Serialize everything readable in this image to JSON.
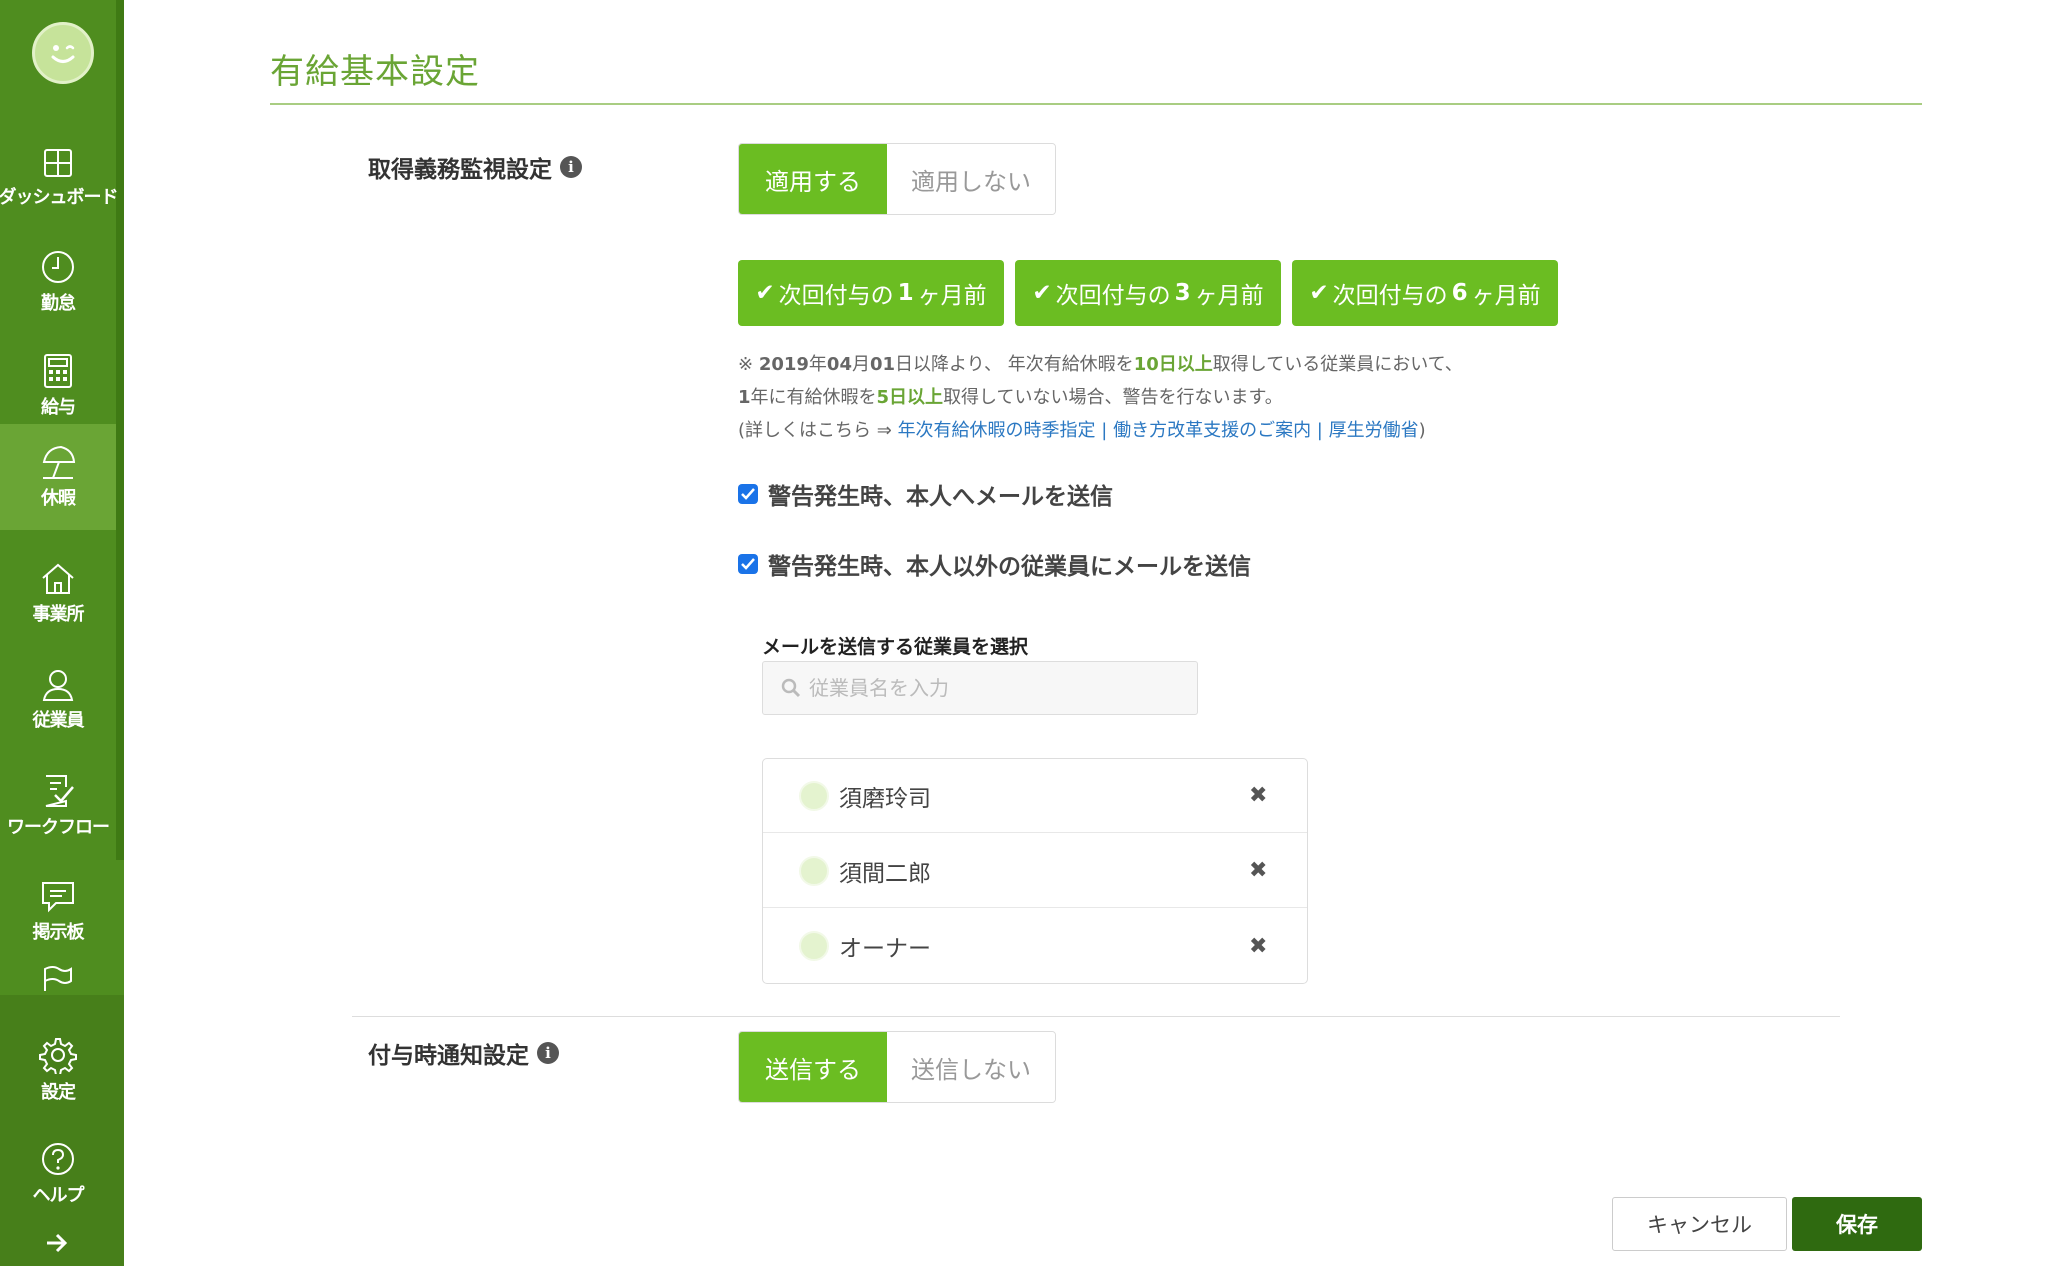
{
  "sidebar": {
    "items": [
      {
        "label": "ダッシュボード",
        "icon": "dashboard-icon"
      },
      {
        "label": "勤怠",
        "icon": "clock-icon"
      },
      {
        "label": "給与",
        "icon": "calculator-icon"
      },
      {
        "label": "休暇",
        "icon": "umbrella-icon"
      },
      {
        "label": "事業所",
        "icon": "home-icon"
      },
      {
        "label": "従業員",
        "icon": "user-icon"
      },
      {
        "label": "ワークフロー",
        "icon": "checklist-icon"
      },
      {
        "label": "掲示板",
        "icon": "message-icon"
      },
      {
        "label": "設定",
        "icon": "gear-icon"
      },
      {
        "label": "ヘルプ",
        "icon": "help-icon"
      }
    ],
    "active_index": 3,
    "expand_icon": "arrow-right-icon"
  },
  "page": {
    "title": "有給基本設定"
  },
  "obligation": {
    "label": "取得義務監視設定",
    "info_icon": "i",
    "toggle": {
      "on_label": "適用する",
      "off_label": "適用しない",
      "selected": "on"
    },
    "timing_buttons": [
      {
        "prefix": "次回付与の",
        "num": "1",
        "suffix": "ヶ月前"
      },
      {
        "prefix": "次回付与の",
        "num": "3",
        "suffix": "ヶ月前"
      },
      {
        "prefix": "次回付与の",
        "num": "6",
        "suffix": "ヶ月前"
      }
    ],
    "note": {
      "line1_a": "※ ",
      "line1_date": "2019",
      "line1_b": "年",
      "line1_m": "04",
      "line1_c": "月",
      "line1_d": "01",
      "line1_e": "日以降より、 年次有給休暇を",
      "line1_hl": "10日以上",
      "line1_f": "取得している従業員において、",
      "line2_a": "1",
      "line2_b": "年に有給休暇を",
      "line2_hl": "5日以上",
      "line2_c": "取得していない場合、警告を行ないます。",
      "line3_a": "(詳しくはこちら ⇒ ",
      "line3_link1": "年次有給休暇の時季指定",
      "line3_sep1": " | ",
      "line3_link2": "働き方改革支援のご案内",
      "line3_sep2": " | ",
      "line3_link3": "厚生労働省",
      "line3_b": ")"
    },
    "check_self": {
      "label": "警告発生時、本人へメールを送信",
      "checked": true
    },
    "check_others": {
      "label": "警告発生時、本人以外の従業員にメールを送信",
      "checked": true
    },
    "select_label": "メールを送信する従業員を選択",
    "search_placeholder": "従業員名を入力",
    "employees": [
      {
        "name": "須磨玲司"
      },
      {
        "name": "須間二郎"
      },
      {
        "name": "オーナー"
      }
    ],
    "remove_glyph": "✖"
  },
  "grant_notice": {
    "label": "付与時通知設定",
    "info_icon": "i",
    "toggle": {
      "on_label": "送信する",
      "off_label": "送信しない",
      "selected": "on"
    }
  },
  "footer": {
    "cancel_label": "キャンセル",
    "save_label": "保存"
  },
  "colors": {
    "sidebar": "#4f8d1f",
    "accent": "#6bbd22",
    "title": "#6aa535",
    "save": "#2f6a10",
    "link": "#2b78c2"
  }
}
